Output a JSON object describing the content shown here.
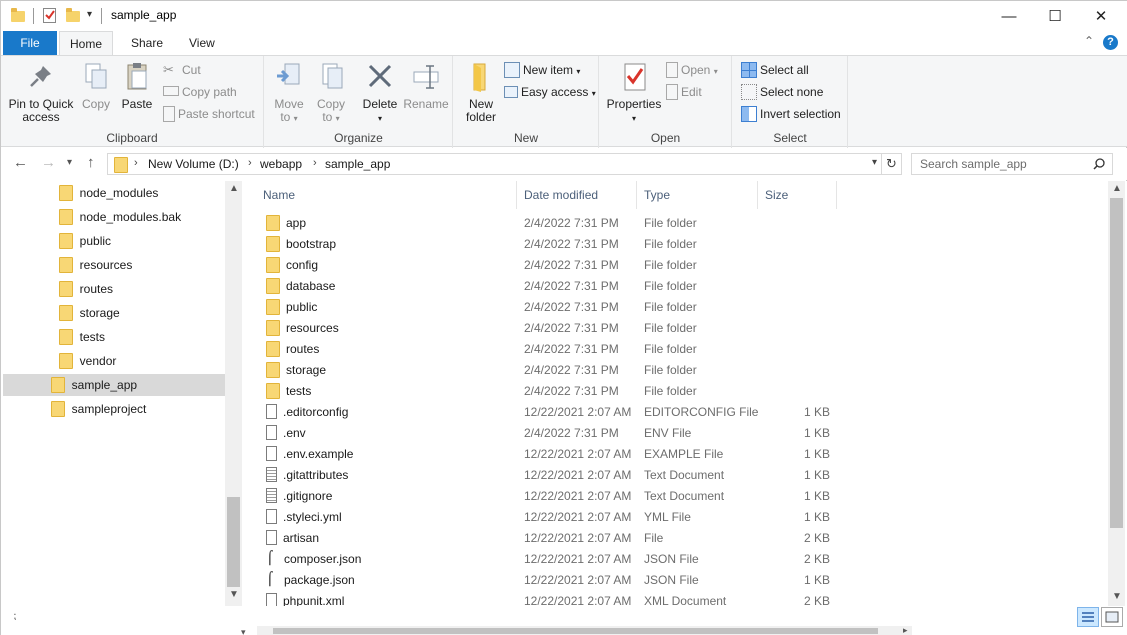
{
  "window": {
    "title": "sample_app"
  },
  "tabs": [
    {
      "label": "File"
    },
    {
      "label": "Home"
    },
    {
      "label": "Share"
    },
    {
      "label": "View"
    }
  ],
  "ribbon": {
    "clipboard": {
      "label": "Clipboard",
      "pin": "Pin to Quick access",
      "pin_line1": "Pin to Quick",
      "pin_line2": "access",
      "copy": "Copy",
      "paste": "Paste",
      "cut": "Cut",
      "copy_path": "Copy path",
      "paste_shortcut": "Paste shortcut"
    },
    "organize": {
      "label": "Organize",
      "move_to": "Move",
      "move_to_2": "to",
      "copy_to": "Copy",
      "copy_to_2": "to",
      "delete": "Delete",
      "rename": "Rename"
    },
    "new": {
      "label": "New",
      "new_folder_1": "New",
      "new_folder_2": "folder",
      "new_item": "New item",
      "easy_access": "Easy access"
    },
    "open": {
      "label": "Open",
      "properties": "Properties",
      "open": "Open",
      "edit": "Edit"
    },
    "select": {
      "label": "Select",
      "select_all": "Select all",
      "select_none": "Select none",
      "invert_selection": "Invert selection"
    }
  },
  "address": {
    "crumbs": [
      "New Volume (D:)",
      "webapp",
      "sample_app"
    ],
    "search_placeholder": "Search sample_app"
  },
  "nav": {
    "items": [
      {
        "label": "node_modules"
      },
      {
        "label": "node_modules.bak"
      },
      {
        "label": "public"
      },
      {
        "label": "resources"
      },
      {
        "label": "routes"
      },
      {
        "label": "storage"
      },
      {
        "label": "tests"
      },
      {
        "label": "vendor"
      },
      {
        "label": "sample_app"
      },
      {
        "label": "sampleproject"
      }
    ]
  },
  "columns": {
    "name": "Name",
    "date": "Date modified",
    "type": "Type",
    "size": "Size"
  },
  "files": [
    {
      "name": "app",
      "date": "2/4/2022 7:31 PM",
      "type": "File folder",
      "size": "",
      "icon": "folder-icon"
    },
    {
      "name": "bootstrap",
      "date": "2/4/2022 7:31 PM",
      "type": "File folder",
      "size": "",
      "icon": "folder-icon"
    },
    {
      "name": "config",
      "date": "2/4/2022 7:31 PM",
      "type": "File folder",
      "size": "",
      "icon": "folder-icon"
    },
    {
      "name": "database",
      "date": "2/4/2022 7:31 PM",
      "type": "File folder",
      "size": "",
      "icon": "folder-icon"
    },
    {
      "name": "public",
      "date": "2/4/2022 7:31 PM",
      "type": "File folder",
      "size": "",
      "icon": "folder-icon"
    },
    {
      "name": "resources",
      "date": "2/4/2022 7:31 PM",
      "type": "File folder",
      "size": "",
      "icon": "folder-icon"
    },
    {
      "name": "routes",
      "date": "2/4/2022 7:31 PM",
      "type": "File folder",
      "size": "",
      "icon": "folder-icon"
    },
    {
      "name": "storage",
      "date": "2/4/2022 7:31 PM",
      "type": "File folder",
      "size": "",
      "icon": "folder-icon"
    },
    {
      "name": "tests",
      "date": "2/4/2022 7:31 PM",
      "type": "File folder",
      "size": "",
      "icon": "folder-icon"
    },
    {
      "name": ".editorconfig",
      "date": "12/22/2021 2:07 AM",
      "type": "EDITORCONFIG File",
      "size": "1 KB",
      "icon": "file-icon"
    },
    {
      "name": ".env",
      "date": "2/4/2022 7:31 PM",
      "type": "ENV File",
      "size": "1 KB",
      "icon": "file-icon"
    },
    {
      "name": ".env.example",
      "date": "12/22/2021 2:07 AM",
      "type": "EXAMPLE File",
      "size": "1 KB",
      "icon": "file-icon"
    },
    {
      "name": ".gitattributes",
      "date": "12/22/2021 2:07 AM",
      "type": "Text Document",
      "size": "1 KB",
      "icon": "text-document-icon"
    },
    {
      "name": ".gitignore",
      "date": "12/22/2021 2:07 AM",
      "type": "Text Document",
      "size": "1 KB",
      "icon": "text-document-icon"
    },
    {
      "name": ".styleci.yml",
      "date": "12/22/2021 2:07 AM",
      "type": "YML File",
      "size": "1 KB",
      "icon": "file-icon"
    },
    {
      "name": "artisan",
      "date": "12/22/2021 2:07 AM",
      "type": "File",
      "size": "2 KB",
      "icon": "file-icon"
    },
    {
      "name": "composer.json",
      "date": "12/22/2021 2:07 AM",
      "type": "JSON File",
      "size": "2 KB",
      "icon": "json-file-icon"
    },
    {
      "name": "package.json",
      "date": "12/22/2021 2:07 AM",
      "type": "JSON File",
      "size": "1 KB",
      "icon": "json-file-icon"
    },
    {
      "name": "phpunit.xml",
      "date": "12/22/2021 2:07 AM",
      "type": "XML Document",
      "size": "2 KB",
      "icon": "file-icon"
    }
  ]
}
